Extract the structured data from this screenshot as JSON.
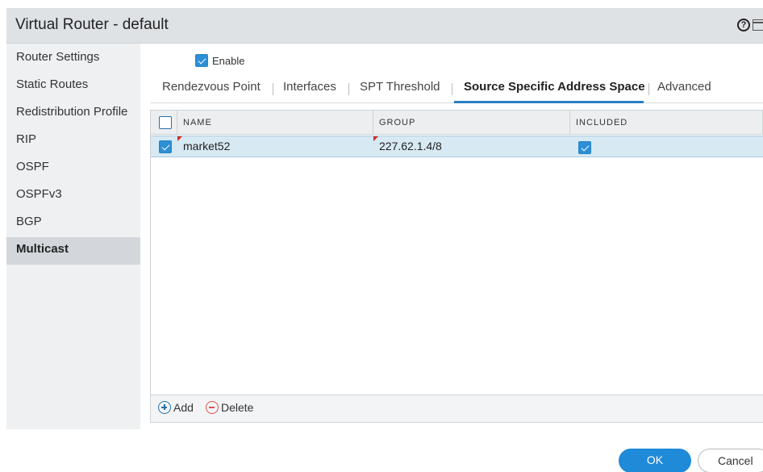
{
  "window": {
    "title": "Virtual Router - default",
    "help_icon": "question-circle-icon",
    "maximize_icon": "maximize-icon"
  },
  "sidebar": {
    "items": [
      {
        "label": "Router Settings"
      },
      {
        "label": "Static Routes"
      },
      {
        "label": "Redistribution Profile"
      },
      {
        "label": "RIP"
      },
      {
        "label": "OSPF"
      },
      {
        "label": "OSPFv3"
      },
      {
        "label": "BGP"
      },
      {
        "label": "Multicast",
        "active": true
      }
    ]
  },
  "enable": {
    "label": "Enable",
    "checked": true
  },
  "tabs": [
    {
      "label": "Rendezvous Point"
    },
    {
      "label": "Interfaces"
    },
    {
      "label": "SPT Threshold"
    },
    {
      "label": "Source Specific Address Space",
      "active": true
    },
    {
      "label": "Advanced"
    }
  ],
  "table": {
    "columns": [
      "NAME",
      "GROUP",
      "INCLUDED"
    ],
    "rows": [
      {
        "selected": true,
        "name": "market52",
        "group": "227.62.1.4/8",
        "included": true
      }
    ]
  },
  "footer": {
    "add_label": "Add",
    "delete_label": "Delete"
  },
  "dialog_buttons": {
    "ok_label": "OK",
    "cancel_label": "Cancel"
  },
  "colors": {
    "accent": "#2b7ec4",
    "ok_button": "#1f8ad8",
    "selected_row": "#d7e9f3",
    "delete": "#e05050"
  }
}
